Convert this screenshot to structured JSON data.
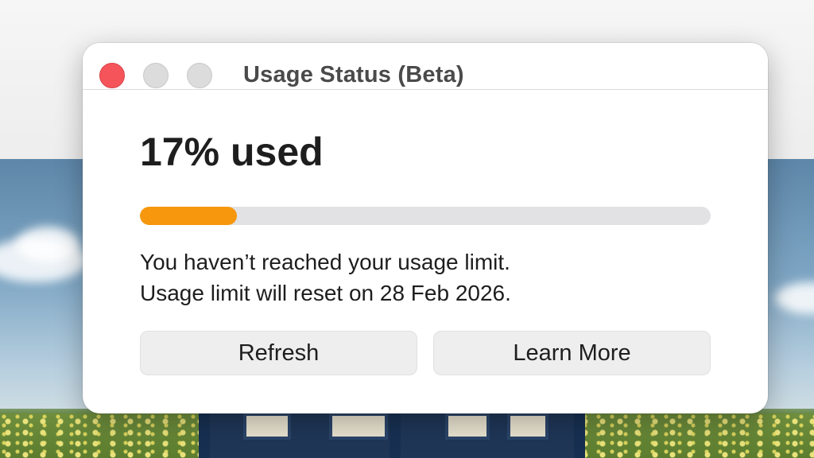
{
  "window": {
    "title": "Usage Status (Beta)",
    "controls": {
      "close_color": "#f5555a",
      "inactive_color": "#dcdcdc"
    }
  },
  "usage": {
    "headline": "17% used",
    "percent_used": 17,
    "bar_color": "#f6970d",
    "track_color": "#e2e2e5"
  },
  "messages": {
    "line1": "You haven’t reached your usage limit.",
    "line2": "Usage limit will reset on 28 Feb 2026."
  },
  "buttons": {
    "refresh": "Refresh",
    "learn_more": "Learn More"
  }
}
